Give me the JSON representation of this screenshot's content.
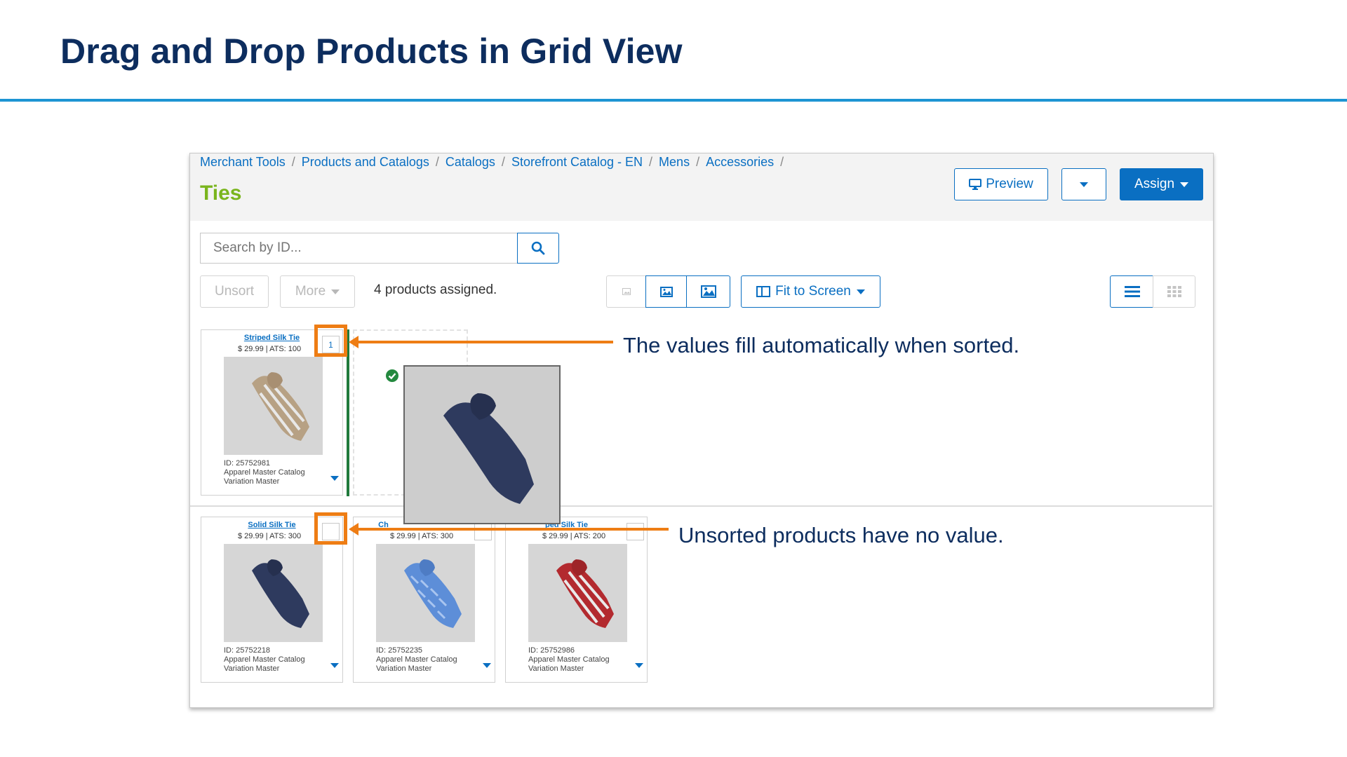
{
  "slide": {
    "title": "Drag and Drop Products in Grid View"
  },
  "breadcrumb": [
    "Merchant Tools",
    "Products and Catalogs",
    "Catalogs",
    "Storefront Catalog - EN",
    "Mens",
    "Accessories"
  ],
  "header": {
    "page_title": "Ties",
    "preview_label": "Preview",
    "assign_label": "Assign"
  },
  "search": {
    "placeholder": "Search by ID..."
  },
  "toolbar": {
    "unsort_label": "Unsort",
    "more_label": "More",
    "assigned_text": "4 products assigned.",
    "fit_label": "Fit to Screen"
  },
  "products": [
    {
      "name": "Striped Silk Tie",
      "price": "$ 29.99",
      "ats": "ATS: 100",
      "id": "ID: 25752981",
      "catalog": "Apparel Master Catalog",
      "type": "Variation Master",
      "sort_value": "1",
      "tie_color": "#b7a184"
    },
    {
      "name": "Solid Silk Tie",
      "price": "$ 29.99",
      "ats": "ATS: 300",
      "id": "ID: 25752218",
      "catalog": "Apparel Master Catalog",
      "type": "Variation Master",
      "sort_value": "",
      "tie_color": "#2e3a5e"
    },
    {
      "name": "Ch",
      "price": "$ 29.99",
      "ats": "ATS: 300",
      "id": "ID: 25752235",
      "catalog": "Apparel Master Catalog",
      "type": "Variation Master",
      "sort_value": "",
      "tie_color": "#5d8ed8"
    },
    {
      "name": "ped Silk Tie",
      "price": "$ 29.99",
      "ats": "ATS: 200",
      "id": "ID: 25752986",
      "catalog": "Apparel Master Catalog",
      "type": "Variation Master",
      "sort_value": "",
      "tie_color": "#b32a2f"
    }
  ],
  "annotations": {
    "sorted_note": "The values fill automatically when sorted.",
    "unsorted_note": "Unsorted products have no value."
  },
  "colors": {
    "title": "#0d2d5e",
    "accent_rule": "#1d95d3",
    "primary": "#0a6fc2",
    "page_title": "#7ab51d",
    "highlight": "#ee7d14",
    "drop_indicator": "#207a3c"
  }
}
